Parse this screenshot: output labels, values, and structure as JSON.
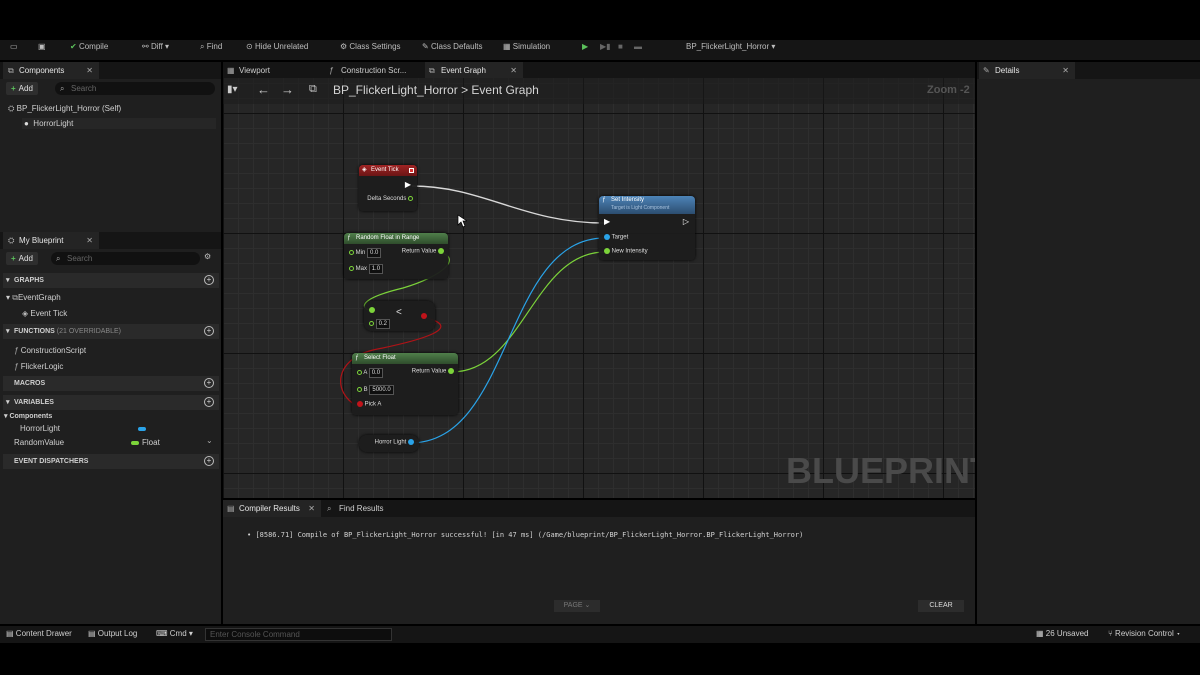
{
  "toolbar": {
    "compile": "Compile",
    "diff": "Diff",
    "find": "Find",
    "hide_unrelated": "Hide Unrelated",
    "class_settings": "Class Settings",
    "class_defaults": "Class Defaults",
    "simulation": "Simulation",
    "debug_object": "BP_FlickerLight_Horror"
  },
  "components_panel": {
    "title": "Components",
    "add_label": "Add",
    "search_placeholder": "Search",
    "items": [
      {
        "label": "BP_FlickerLight_Horror (Self)"
      },
      {
        "label": "HorrorLight"
      }
    ]
  },
  "my_blueprint": {
    "title": "My Blueprint",
    "add_label": "Add",
    "search_placeholder": "Search",
    "graphs_label": "GRAPHS",
    "event_graph": "EventGraph",
    "event_tick": "Event Tick",
    "functions_label": "FUNCTIONS",
    "functions_count": "(21 OVERRIDABLE)",
    "construction_script": "ConstructionScript",
    "flicker_logic": "FlickerLogic",
    "macros_label": "MACROS",
    "variables_label": "VARIABLES",
    "components_label": "Components",
    "var_horror_light": "HorrorLight",
    "var_random_value": "RandomValue",
    "var_random_type": "Float",
    "event_dispatchers_label": "EVENT DISPATCHERS"
  },
  "editor_tabs": {
    "viewport": "Viewport",
    "construction_script": "Construction Scr...",
    "event_graph": "Event Graph"
  },
  "graph": {
    "breadcrumb_bp": "BP_FlickerLight_Horror",
    "breadcrumb_sep": ">",
    "breadcrumb_graph": "Event Graph",
    "zoom": "Zoom -2",
    "watermark": "BLUEPRINT",
    "nodes": {
      "event_tick": {
        "title": "Event Tick",
        "delta": "Delta Seconds"
      },
      "random_float": {
        "title": "Random Float in Range",
        "min_label": "Min",
        "min_value": "0.0",
        "max_label": "Max",
        "max_value": "1.0",
        "return_label": "Return Value"
      },
      "less": {
        "symbol": "<",
        "value": "0.2"
      },
      "select_float": {
        "title": "Select Float",
        "a_label": "A",
        "a_value": "0.0",
        "b_label": "B",
        "b_value": "5000.0",
        "pick_label": "Pick A",
        "return_label": "Return Value"
      },
      "horror_light": {
        "label": "Horror Light"
      },
      "set_intensity": {
        "title": "Set Intensity",
        "subtitle": "Target is Light Component",
        "target": "Target",
        "new_intensity": "New Intensity"
      }
    }
  },
  "details": {
    "title": "Details"
  },
  "compiler": {
    "tab_results": "Compiler Results",
    "tab_find": "Find Results",
    "message": "[8586.71] Compile of BP_FlickerLight_Horror successful! [in 47 ms] (/Game/blueprint/BP_FlickerLight_Horror.BP_FlickerLight_Horror)",
    "page_label": "PAGE",
    "clear_label": "CLEAR"
  },
  "status_bar": {
    "content_drawer": "Content Drawer",
    "output_log": "Output Log",
    "cmd": "Cmd",
    "console_placeholder": "Enter Console Command",
    "unsaved": "26 Unsaved",
    "revision_control": "Revision Control"
  },
  "colors": {
    "exec": "#ffffff",
    "float_pin": "#7cd43a",
    "object_pin": "#2aa3e8",
    "bool_pin": "#c0131a",
    "event_header": "#8b1a1a",
    "function_header": "#3f6b3a",
    "target_header": "#3d6b9a"
  }
}
